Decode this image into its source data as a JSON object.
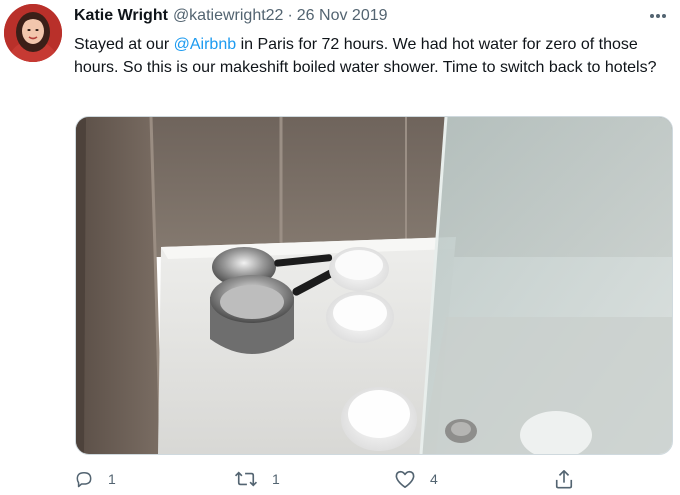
{
  "tweet": {
    "author_name": "Katie Wright",
    "handle": "@katiewright22",
    "separator": "·",
    "date": "26 Nov 2019",
    "text_before": "Stayed at our ",
    "mention": "@Airbnb",
    "text_after": " in Paris for 72 hours. We had hot water for zero of those hours. So this is our makeshift boiled water shower. Time to switch back to hotels?",
    "replies": "1",
    "retweets": "1",
    "likes": "4"
  },
  "icons": {
    "more": "more-dots-icon",
    "reply": "reply-icon",
    "retweet": "retweet-icon",
    "like": "heart-icon",
    "share": "share-icon"
  },
  "colors": {
    "accent": "#1d9bf0",
    "secondary_text": "#536471"
  }
}
